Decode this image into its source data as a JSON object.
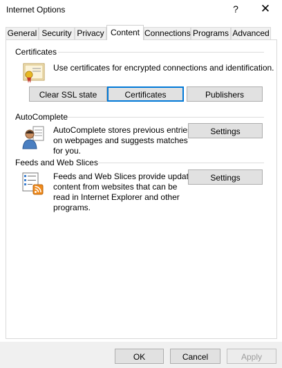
{
  "window": {
    "title": "Internet Options",
    "help_glyph": "?",
    "close_glyph": "✕"
  },
  "tabs": [
    {
      "label": "General"
    },
    {
      "label": "Security"
    },
    {
      "label": "Privacy"
    },
    {
      "label": "Content"
    },
    {
      "label": "Connections"
    },
    {
      "label": "Programs"
    },
    {
      "label": "Advanced"
    }
  ],
  "active_tab": "Content",
  "certificates": {
    "title": "Certificates",
    "description": "Use certificates for encrypted connections and identification.",
    "clear_ssl_label": "Clear SSL state",
    "certificates_label": "Certificates",
    "publishers_label": "Publishers",
    "icon": "certificate-icon"
  },
  "autocomplete": {
    "title": "AutoComplete",
    "description_lines": [
      "AutoComplete stores previous entries",
      "on webpages and suggests matches",
      "for you."
    ],
    "settings_label": "Settings",
    "icon": "autocomplete-user-icon"
  },
  "feeds": {
    "title": "Feeds and Web Slices",
    "description_lines": [
      "Feeds and Web Slices provide updated",
      "content from websites that can be",
      "read in Internet Explorer and other",
      "programs."
    ],
    "settings_label": "Settings",
    "icon": "feed-list-icon"
  },
  "footer": {
    "ok_label": "OK",
    "cancel_label": "Cancel",
    "apply_label": "Apply"
  },
  "colors": {
    "focus_border": "#0078d7",
    "button_face": "#e1e1e1",
    "footer_bg": "#f0f0f0",
    "rss_orange": "#f08a1c"
  }
}
